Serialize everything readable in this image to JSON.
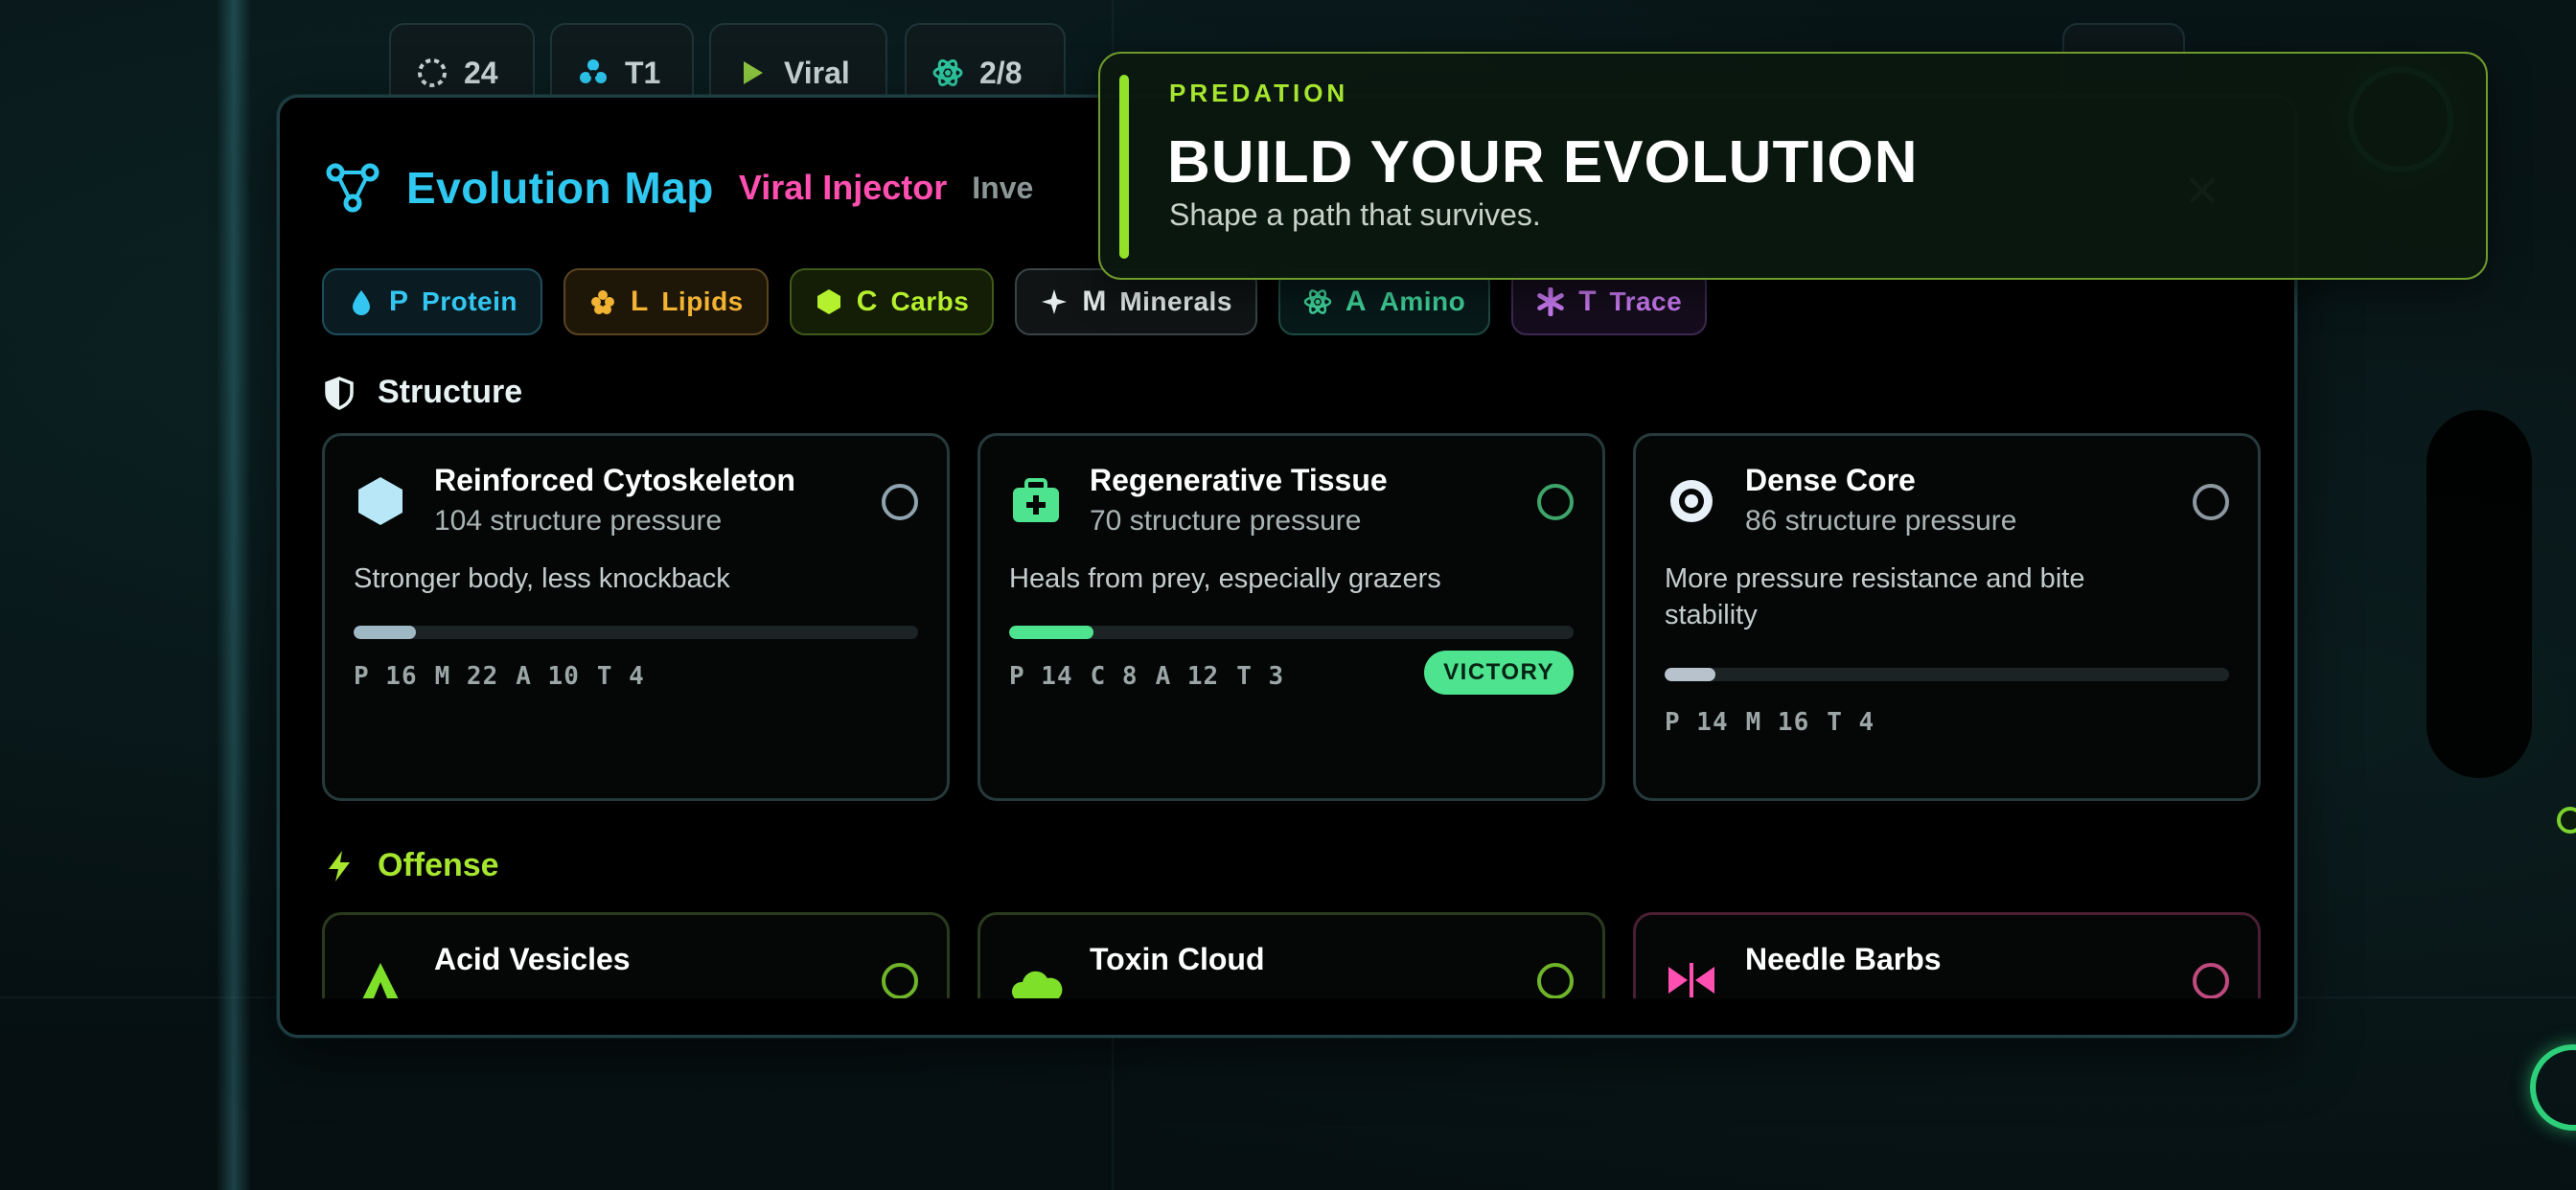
{
  "hud": {
    "cells": "24",
    "tier": "T1",
    "mode": "Viral",
    "progress": "2/8"
  },
  "panel": {
    "title": "Evolution Map",
    "subtitle": "Viral Injector",
    "extra": "Inve",
    "close_label": "×"
  },
  "nutrients": [
    {
      "letter": "P",
      "label": "Protein",
      "color": "#33c6f0",
      "bg": "#0a1c22",
      "border": "#1d4d5a",
      "icon": "drop-icon"
    },
    {
      "letter": "L",
      "label": "Lipids",
      "color": "#f2b233",
      "bg": "#1e1708",
      "border": "#5a4520",
      "icon": "lipid-cluster-icon"
    },
    {
      "letter": "C",
      "label": "Carbs",
      "color": "#b5f02e",
      "bg": "#141d06",
      "border": "#3f5a1a",
      "icon": "hexagon-icon"
    },
    {
      "letter": "M",
      "label": "Minerals",
      "color": "#e6ecec",
      "bg": "#101414",
      "border": "#3a4446",
      "icon": "sparkle-icon"
    },
    {
      "letter": "A",
      "label": "Amino",
      "color": "#3fd39a",
      "bg": "#08191a",
      "border": "#1d4a40",
      "icon": "atom-icon"
    },
    {
      "letter": "T",
      "label": "Trace",
      "color": "#c879f0",
      "bg": "#150d1d",
      "border": "#3e2a52",
      "icon": "asterisk-icon"
    }
  ],
  "sections": {
    "structure": {
      "title": "Structure",
      "color": "#e8f2f2"
    },
    "offense": {
      "title": "Offense",
      "color": "#a6e62e"
    }
  },
  "structure_cards": [
    {
      "name": "Reinforced Cytoskeleton",
      "sub": "104 structure pressure",
      "desc": "Stronger body, less knockback",
      "progress": 0.11,
      "bar_color": "#9fb9c4",
      "costs": [
        "P 16",
        "M 22",
        "A 10",
        "T 4"
      ],
      "radio_color": "#8fa3ae",
      "icon": "hexagon-shield-icon",
      "icon_color": "#b8e8f8"
    },
    {
      "name": "Regenerative Tissue",
      "sub": "70 structure pressure",
      "desc": "Heals from prey, especially grazers",
      "progress": 0.15,
      "bar_color": "#4de38f",
      "costs": [
        "P 14",
        "C 8",
        "A 12",
        "T 3"
      ],
      "radio_color": "#3ea56a",
      "badge": "VICTORY",
      "icon": "medkit-icon",
      "icon_color": "#4de38f"
    },
    {
      "name": "Dense Core",
      "sub": "86 structure pressure",
      "desc": "More pressure resistance and bite stability",
      "progress": 0.09,
      "bar_color": "#b7c2cc",
      "costs": [
        "P 14",
        "M 16",
        "T 4"
      ],
      "radio_color": "#8d98a0",
      "icon": "target-core-icon",
      "icon_color": "#e8f0f8"
    }
  ],
  "offense_cards": [
    {
      "name": "Acid Vesicles",
      "radio_color": "#6fb52a",
      "icon": "acid-flame-icon",
      "icon_color": "#7fe02a",
      "border": "#2a3a1e"
    },
    {
      "name": "Toxin Cloud",
      "radio_color": "#6fb52a",
      "icon": "cloud-icon",
      "icon_color": "#7fe02a",
      "border": "#2a3a1e"
    },
    {
      "name": "Needle Barbs",
      "radio_color": "#c04a7e",
      "icon": "barbs-icon",
      "icon_color": "#ff4fb0",
      "border": "#4a1f33"
    }
  ],
  "toast": {
    "tag": "PREDATION",
    "title": "BUILD YOUR EVOLUTION",
    "subtitle": "Shape a path that survives."
  }
}
